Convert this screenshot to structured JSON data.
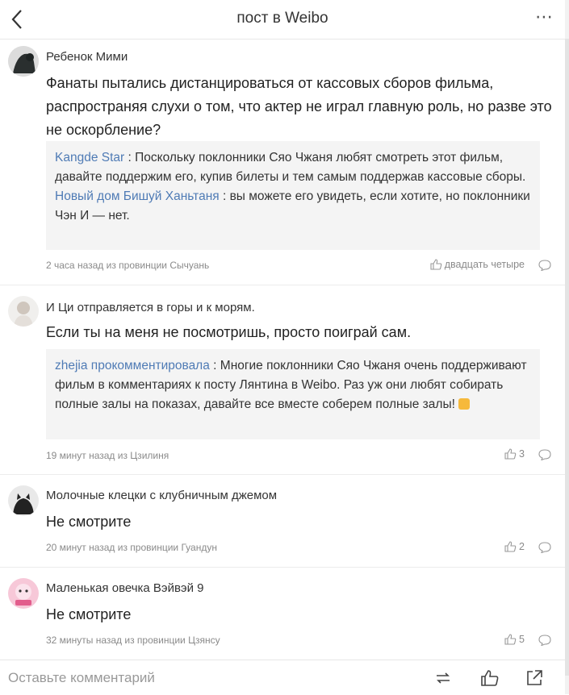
{
  "header": {
    "title": "пост в Weibo"
  },
  "comments": [
    {
      "author": "Ребенок Мими",
      "text": "Фанаты пытались дистанцироваться от кассовых сборов фильма, распространяя слухи о том, что актер не играл главную роль, но разве это не оскорбление?",
      "replies": [
        {
          "name": "Kangde Star",
          "text": " : Поскольку поклонники Сяо Чжаня любят смотреть этот фильм, давайте поддержим его, купив билеты и тем самым поддержав кассовые сборы."
        },
        {
          "name": "Новый дом Бишуй Ханьтаня",
          "text": " : вы можете его увидеть, если хотите, но поклонники Чэн И — нет."
        }
      ],
      "meta": "2 часа назад из провинции Сычуань",
      "likes": "двадцать четыре"
    },
    {
      "author": "И Ци отправляется в горы и к морям.",
      "text": "Если ты на меня не посмотришь, просто поиграй сам.",
      "replies": [
        {
          "name": "zhejia прокомментировала",
          "text": " : Многие поклонники Сяо Чжаня очень поддерживают фильм в комментариях к посту Лянтина в Weibo. Раз уж они любят собирать полные залы на показах, давайте все вместе соберем полные залы!"
        }
      ],
      "meta": "19 минут назад из Цзилиня",
      "likes": "3"
    },
    {
      "author": "Молочные клецки с клубничным джемом",
      "text": "Не смотрите",
      "meta": "20 минут назад из провинции Гуандун",
      "likes": "2"
    },
    {
      "author": "Маленькая овечка Вэйвэй 9",
      "text": "Не смотрите",
      "meta": "32 минуты назад из провинции Цзянсу",
      "likes": "5"
    }
  ],
  "footer": {
    "placeholder": "Оставьте комментарий"
  },
  "colors": {
    "link": "#4f7bb5",
    "quote_bg": "#f4f4f4",
    "meta": "#8a8a8a"
  },
  "icons": [
    "back-icon",
    "more-icon",
    "like-icon",
    "reply-icon",
    "repost-icon",
    "share-icon"
  ]
}
